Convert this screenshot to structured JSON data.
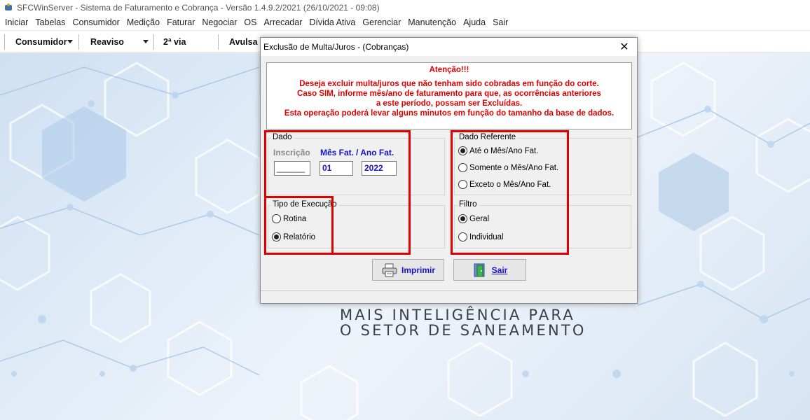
{
  "window": {
    "title": "SFCWinServer - Sistema de Faturamento e Cobrança - Versão 1.4.9.2/2021 (26/10/2021 - 09:08)"
  },
  "menu": [
    "Iniciar",
    "Tabelas",
    "Consumidor",
    "Medição",
    "Faturar",
    "Negociar",
    "OS",
    "Arrecadar",
    "Dívida Ativa",
    "Gerenciar",
    "Manutenção",
    "Ajuda",
    "Sair"
  ],
  "toolbar": {
    "consumidor": "Consumidor",
    "reaviso": "Reaviso",
    "segunda_via": "2ª via",
    "avulsa": "Avulsa"
  },
  "background": {
    "slogan_line1": "MAIS INTELIGÊNCIA PARA",
    "slogan_line2": "O SETOR DE SANEAMENTO"
  },
  "dialog": {
    "title": "Exclusão de Multa/Juros - (Cobranças)",
    "close_glyph": "✕",
    "alert": {
      "title": "Atenção!!!",
      "lines": [
        "Deseja excluir multa/juros que não tenham sido cobradas em função do corte.",
        "Caso SIM, informe mês/ano de faturamento para que, as ocorrências anteriores",
        "a este período, possam ser Excluídas.",
        "Esta operação poderá levar alguns minutos em função do tamanho da base de dados."
      ]
    },
    "dado": {
      "label": "Dado",
      "inscricao_label": "Inscrição",
      "mes_label": "Mês Fat.",
      "ano_label": "/ Ano Fat.",
      "inscricao_value": "______",
      "mes_value": "01",
      "ano_value": "2022"
    },
    "tipo_execucao": {
      "label": "Tipo de Execução",
      "options": [
        "Rotina",
        "Relatório"
      ],
      "selected": "Relatório"
    },
    "dado_referente": {
      "label": "Dado Referente",
      "options": [
        "Até o Mês/Ano Fat.",
        "Somente o Mês/Ano Fat.",
        "Exceto o Mês/Ano Fat."
      ],
      "selected": "Até o Mês/Ano Fat."
    },
    "filtro": {
      "label": "Filtro",
      "options": [
        "Geral",
        "Individual"
      ],
      "selected": "Geral"
    },
    "buttons": {
      "imprimir": "Imprimir",
      "sair": "Sair"
    }
  }
}
